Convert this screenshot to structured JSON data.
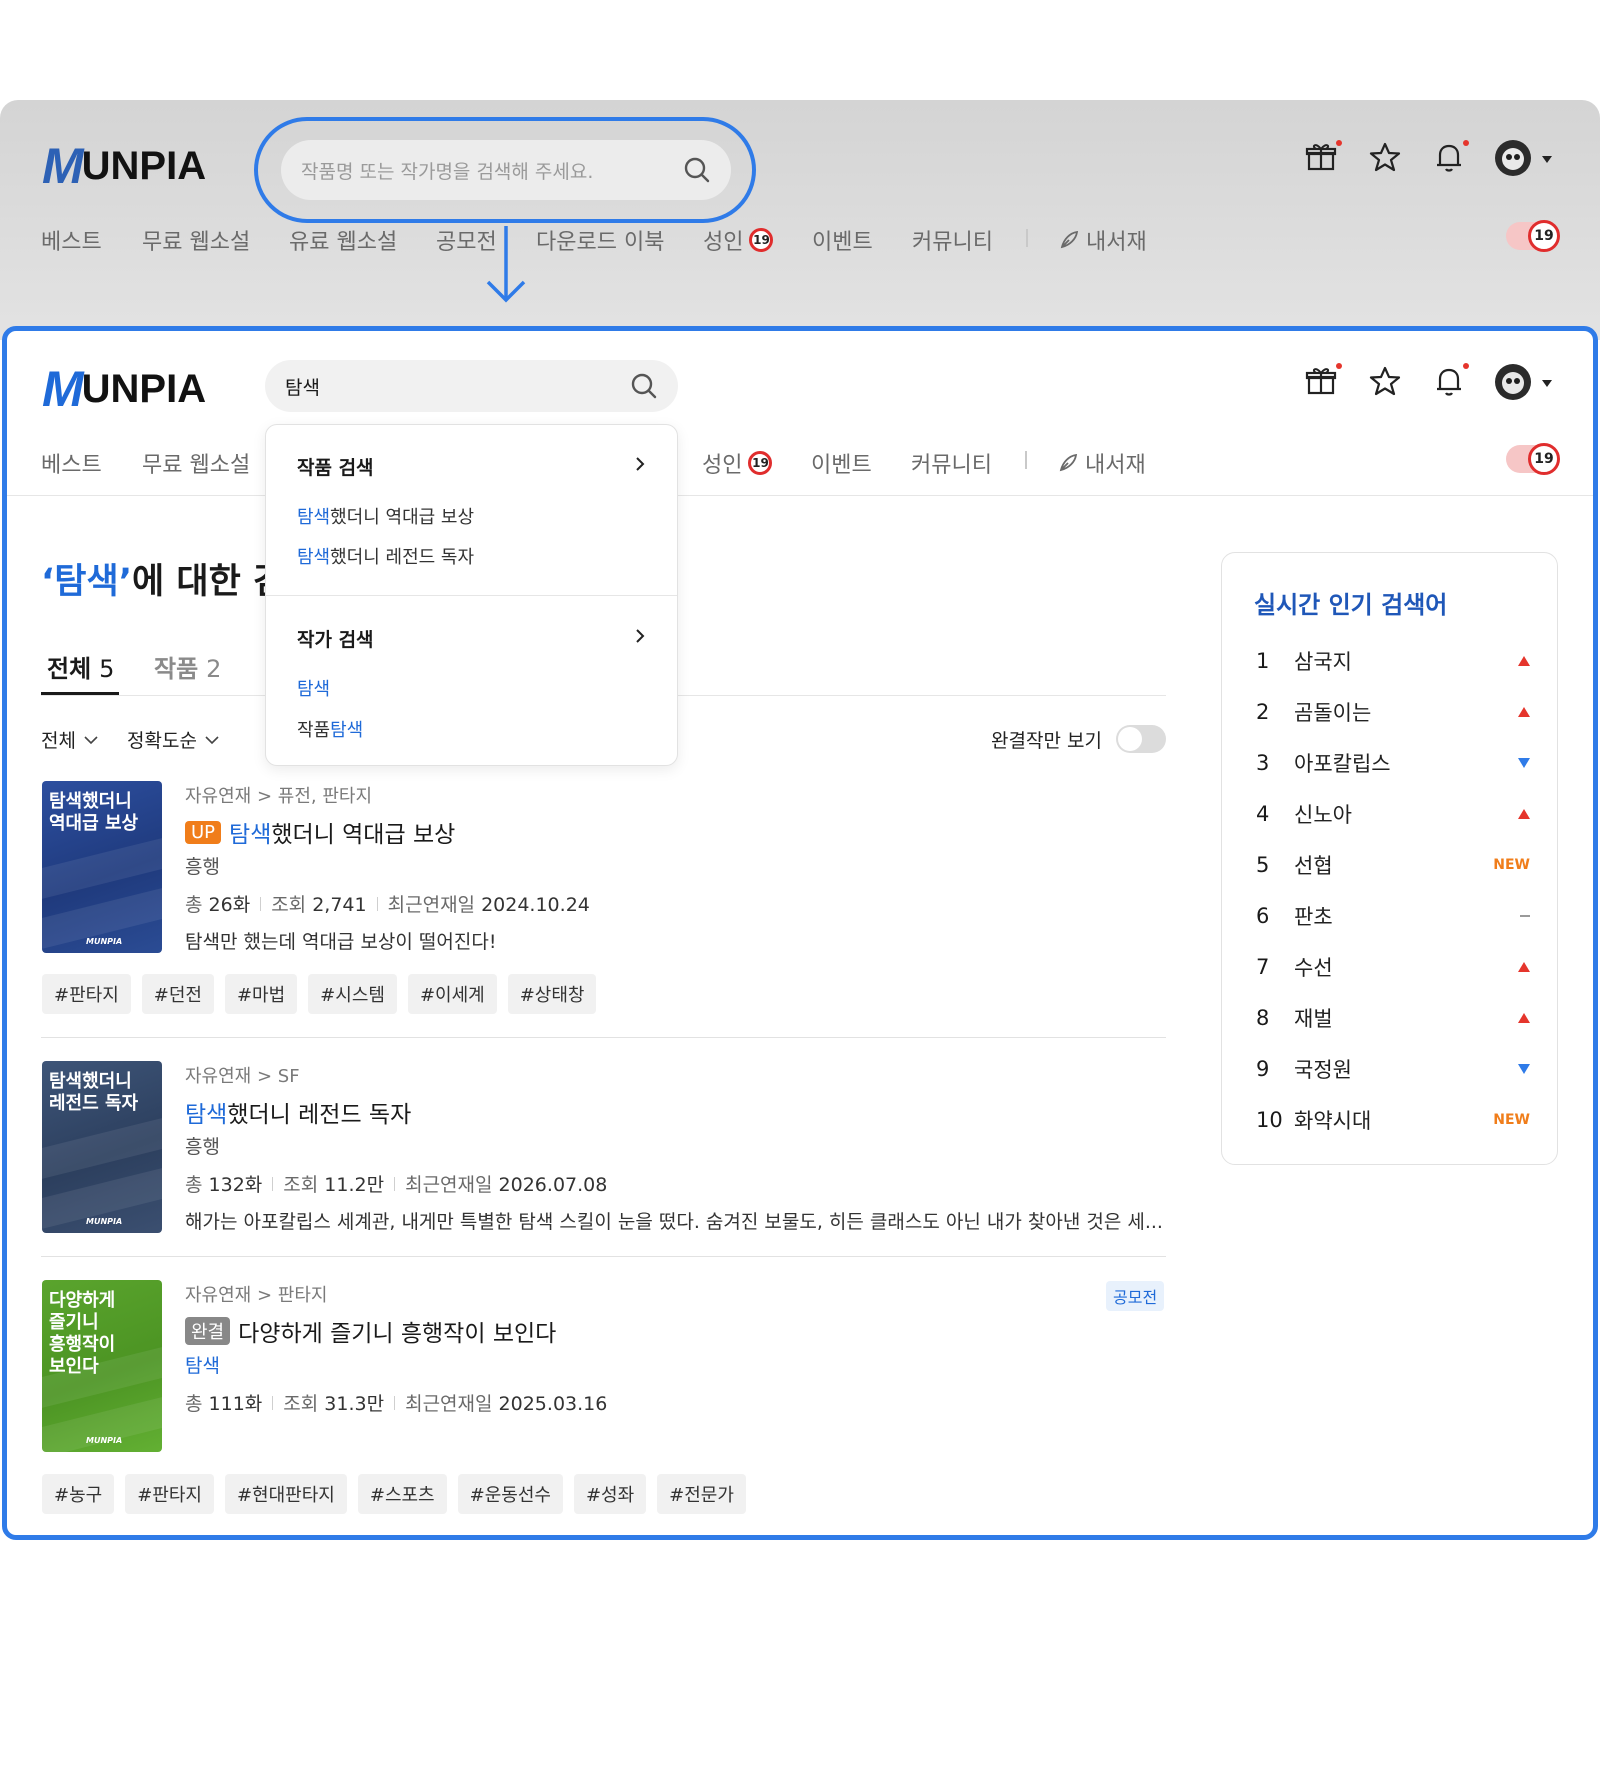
{
  "logo": {
    "m": "M",
    "rest": "UNPIA"
  },
  "top_header": {
    "search_placeholder": "작품명 또는 작가명을 검색해 주세요.",
    "nav": [
      "베스트",
      "무료 웹소설",
      "유료 웹소설",
      "공모전",
      "다운로드 이북",
      "성인",
      "이벤트",
      "커뮤니티",
      "내서재"
    ]
  },
  "badge_19": "19",
  "main_header": {
    "search_value": "탐색",
    "nav": [
      "베스트",
      "무료 웹소설",
      "성인",
      "이벤트",
      "커뮤니티",
      "내서재"
    ]
  },
  "dropdown": {
    "work_section": "작품 검색",
    "work_items": [
      {
        "hl": "탐색",
        "rest": "했더니 역대급 보상"
      },
      {
        "hl": "탐색",
        "rest": "했더니 레전드 독자"
      }
    ],
    "author_section": "작가 검색",
    "author_items": [
      {
        "pre": "",
        "hl": "탐색"
      },
      {
        "pre": "작품",
        "hl": "탐색"
      }
    ]
  },
  "result": {
    "title_query": "‘탐색’",
    "title_rest": "에 대한 검",
    "tabs": [
      {
        "label": "전체",
        "count": "5"
      },
      {
        "label": "작품",
        "count": "2"
      }
    ],
    "filters": [
      "전체",
      "정확도순"
    ],
    "complete_only": "완결작만 보기"
  },
  "works": [
    {
      "cover_text": "탐색했더니\n역대급 보상",
      "cover_logo": "MUNPIA",
      "category": "자유연재 > 퓨전, 판타지",
      "badge": "UP",
      "title_hl": "탐색",
      "title_rest": "했더니 역대급 보상",
      "author": "흥행",
      "episodes": "26화",
      "views": "2,741",
      "updated": "2024.10.24",
      "desc": "탐색만 했는데 역대급 보상이 떨어진다!",
      "tags": [
        "#판타지",
        "#던전",
        "#마법",
        "#시스템",
        "#이세계",
        "#상태창"
      ]
    },
    {
      "cover_text": "탐색했더니\n레전드 독자",
      "cover_logo": "MUNPIA",
      "category": "자유연재 > SF",
      "title_hl": "탐색",
      "title_rest": "했더니 레전드 독자",
      "author": "흥행",
      "episodes": "132화",
      "views": "11.2만",
      "updated": "2026.07.08",
      "desc": "해가는 아포칼립스 세계관, 내게만 특별한 탐색 스킬이 눈을 떴다. 숨겨진 보물도, 히든 클래스도 아닌 내가 찾아낸 것은 세..."
    },
    {
      "cover_text": "다양하게\n즐기니\n흥행작이\n보인다",
      "cover_logo": "MUNPIA",
      "category": "자유연재 > 판타지",
      "contest": "공모전",
      "badge": "완결",
      "title": "다양하게 즐기니 흥행작이 보인다",
      "author": "탐색",
      "episodes": "111화",
      "views": "31.3만",
      "updated": "2025.03.16",
      "tags": [
        "#농구",
        "#판타지",
        "#현대판타지",
        "#스포츠",
        "#운동선수",
        "#성좌",
        "#전문가"
      ]
    }
  ],
  "labels": {
    "total": "총",
    "views": "조회",
    "updated": "최근연재일"
  },
  "realtime": {
    "title": "실시간 인기 검색어",
    "items": [
      {
        "rank": "1",
        "kw": "삼국지",
        "trend": "up"
      },
      {
        "rank": "2",
        "kw": "곰돌이는",
        "trend": "up"
      },
      {
        "rank": "3",
        "kw": "아포칼립스",
        "trend": "down"
      },
      {
        "rank": "4",
        "kw": "신노아",
        "trend": "up"
      },
      {
        "rank": "5",
        "kw": "선협",
        "trend": "new",
        "trend_text": "NEW"
      },
      {
        "rank": "6",
        "kw": "판초",
        "trend": "same"
      },
      {
        "rank": "7",
        "kw": "수선",
        "trend": "up"
      },
      {
        "rank": "8",
        "kw": "재벌",
        "trend": "up"
      },
      {
        "rank": "9",
        "kw": "국정원",
        "trend": "down"
      },
      {
        "rank": "10",
        "kw": "화약시대",
        "trend": "new",
        "trend_text": "NEW"
      }
    ]
  },
  "colors": {
    "accent": "#1f6ad8",
    "frame": "#2f7be8",
    "alert": "#e5352c",
    "up_badge": "#f07d1a"
  },
  "icons": [
    "gift-icon",
    "star-icon",
    "bell-icon",
    "avatar",
    "search-icon",
    "feather-icon",
    "chevron-right-icon",
    "chevron-down-icon",
    "arrow-down-icon"
  ]
}
